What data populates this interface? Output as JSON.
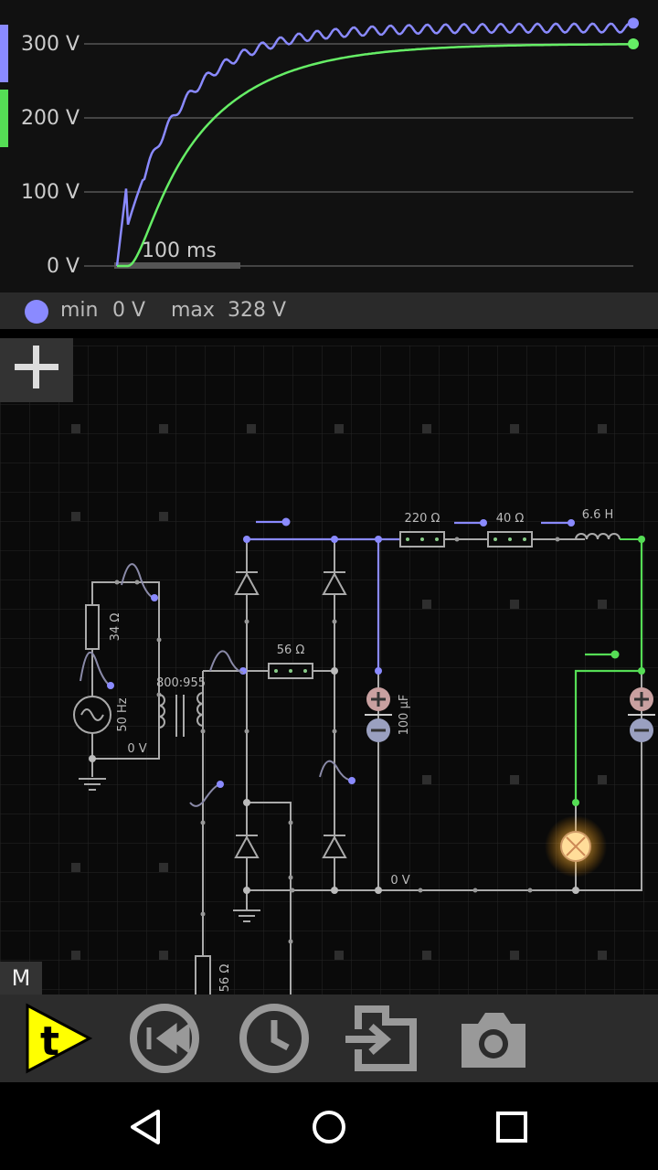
{
  "scope": {
    "y_ticks": [
      "300 V",
      "200 V",
      "100 V",
      "0 V"
    ],
    "time_scale": "100 ms",
    "series_colors": {
      "blue": "#8a8aff",
      "green": "#66ee66"
    },
    "channel_colors": [
      "#8a8aff",
      "#55dd55"
    ]
  },
  "chart_data": {
    "type": "line",
    "ylim": [
      0,
      328
    ],
    "yticks": [
      "300 V",
      "200 V",
      "100 V",
      "0 V"
    ],
    "series": [
      {
        "color": "#8a8aff",
        "final": 328
      },
      {
        "color": "#66ee66",
        "final": 300
      }
    ]
  },
  "info": {
    "min_label": "min",
    "min_value": "0 V",
    "max_label": "max",
    "max_value": "328 V"
  },
  "circuit": {
    "labels": {
      "r34": "34 Ω",
      "freq": "50 Hz",
      "ratio": "800:955",
      "gnd1": "0 V",
      "r56a": "56 Ω",
      "r220": "220 Ω",
      "r40": "40 Ω",
      "l66": "6.6 H",
      "c100": "100 µF",
      "gnd2": "0 V",
      "r56b": "56 Ω"
    }
  },
  "buttons": {
    "add": "plus-icon",
    "mode": "M"
  },
  "toolbar": {
    "items": [
      "time-play",
      "rewind",
      "clock",
      "import",
      "camera"
    ]
  },
  "nav": {
    "items": [
      "back",
      "home",
      "recents"
    ]
  }
}
